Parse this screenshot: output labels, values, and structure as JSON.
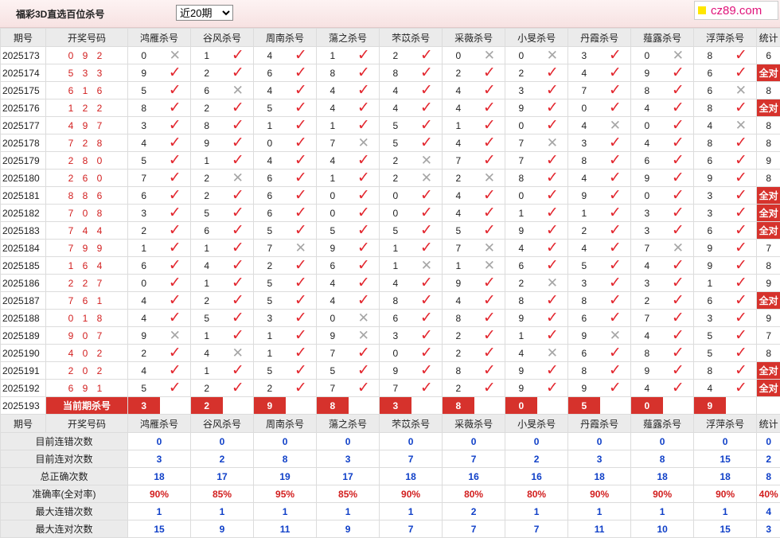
{
  "page": {
    "title": "福彩3D直选百位杀号",
    "select_value": "近20期",
    "logo_text": "cz89.com"
  },
  "header": {
    "period": "期号",
    "code": "开奖号码",
    "stat": "统计",
    "experts": [
      "鸿雁杀号",
      "谷风杀号",
      "周南杀号",
      "蕩之杀号",
      "芣苡杀号",
      "采薇杀号",
      "小旻杀号",
      "丹霞杀号",
      "薤露杀号",
      "浮萍杀号"
    ]
  },
  "rows": [
    {
      "p": "2025173",
      "c": "0 9 2",
      "n": [
        "0",
        "1",
        "4",
        "1",
        "2",
        "0",
        "0",
        "3",
        "0",
        "8"
      ],
      "r": [
        0,
        1,
        1,
        1,
        1,
        0,
        0,
        1,
        0,
        1
      ],
      "s": "6"
    },
    {
      "p": "2025174",
      "c": "5 3 3",
      "n": [
        "9",
        "2",
        "6",
        "8",
        "8",
        "2",
        "2",
        "4",
        "9",
        "6"
      ],
      "r": [
        1,
        1,
        1,
        1,
        1,
        1,
        1,
        1,
        1,
        1
      ],
      "s": "全对"
    },
    {
      "p": "2025175",
      "c": "6 1 6",
      "n": [
        "5",
        "6",
        "4",
        "4",
        "4",
        "4",
        "3",
        "7",
        "8",
        "6"
      ],
      "r": [
        1,
        0,
        1,
        1,
        1,
        1,
        1,
        1,
        1,
        0
      ],
      "s": "8"
    },
    {
      "p": "2025176",
      "c": "1 2 2",
      "n": [
        "8",
        "2",
        "5",
        "4",
        "4",
        "4",
        "9",
        "0",
        "4",
        "8"
      ],
      "r": [
        1,
        1,
        1,
        1,
        1,
        1,
        1,
        1,
        1,
        1
      ],
      "s": "全对"
    },
    {
      "p": "2025177",
      "c": "4 9 7",
      "n": [
        "3",
        "8",
        "1",
        "1",
        "5",
        "1",
        "0",
        "4",
        "0",
        "4"
      ],
      "r": [
        1,
        1,
        1,
        1,
        1,
        1,
        1,
        0,
        1,
        0
      ],
      "s": "8"
    },
    {
      "p": "2025178",
      "c": "7 2 8",
      "n": [
        "4",
        "9",
        "0",
        "7",
        "5",
        "4",
        "7",
        "3",
        "4",
        "8"
      ],
      "r": [
        1,
        1,
        1,
        0,
        1,
        1,
        0,
        1,
        1,
        1
      ],
      "s": "8"
    },
    {
      "p": "2025179",
      "c": "2 8 0",
      "n": [
        "5",
        "1",
        "4",
        "4",
        "2",
        "7",
        "7",
        "8",
        "6",
        "6"
      ],
      "r": [
        1,
        1,
        1,
        1,
        0,
        1,
        1,
        1,
        1,
        1
      ],
      "s": "9"
    },
    {
      "p": "2025180",
      "c": "2 6 0",
      "n": [
        "7",
        "2",
        "6",
        "1",
        "2",
        "2",
        "8",
        "4",
        "9",
        "9"
      ],
      "r": [
        1,
        0,
        1,
        1,
        0,
        0,
        1,
        1,
        1,
        1
      ],
      "s": "8"
    },
    {
      "p": "2025181",
      "c": "8 8 6",
      "n": [
        "6",
        "2",
        "6",
        "0",
        "0",
        "4",
        "0",
        "9",
        "0",
        "3"
      ],
      "r": [
        1,
        1,
        1,
        1,
        1,
        1,
        1,
        1,
        1,
        1
      ],
      "s": "全对"
    },
    {
      "p": "2025182",
      "c": "7 0 8",
      "n": [
        "3",
        "5",
        "6",
        "0",
        "0",
        "4",
        "1",
        "1",
        "3",
        "3"
      ],
      "r": [
        1,
        1,
        1,
        1,
        1,
        1,
        1,
        1,
        1,
        1
      ],
      "s": "全对"
    },
    {
      "p": "2025183",
      "c": "7 4 4",
      "n": [
        "2",
        "6",
        "5",
        "5",
        "5",
        "5",
        "9",
        "2",
        "3",
        "6"
      ],
      "r": [
        1,
        1,
        1,
        1,
        1,
        1,
        1,
        1,
        1,
        1
      ],
      "s": "全对"
    },
    {
      "p": "2025184",
      "c": "7 9 9",
      "n": [
        "1",
        "1",
        "7",
        "9",
        "1",
        "7",
        "4",
        "4",
        "7",
        "9"
      ],
      "r": [
        1,
        1,
        0,
        1,
        1,
        0,
        1,
        1,
        0,
        1
      ],
      "s": "7"
    },
    {
      "p": "2025185",
      "c": "1 6 4",
      "n": [
        "6",
        "4",
        "2",
        "6",
        "1",
        "1",
        "6",
        "5",
        "4",
        "9"
      ],
      "r": [
        1,
        1,
        1,
        1,
        0,
        0,
        1,
        1,
        1,
        1
      ],
      "s": "8"
    },
    {
      "p": "2025186",
      "c": "2 2 7",
      "n": [
        "0",
        "1",
        "5",
        "4",
        "4",
        "9",
        "2",
        "3",
        "3",
        "1"
      ],
      "r": [
        1,
        1,
        1,
        1,
        1,
        1,
        0,
        1,
        1,
        1
      ],
      "s": "9"
    },
    {
      "p": "2025187",
      "c": "7 6 1",
      "n": [
        "4",
        "2",
        "5",
        "4",
        "8",
        "4",
        "8",
        "8",
        "2",
        "6"
      ],
      "r": [
        1,
        1,
        1,
        1,
        1,
        1,
        1,
        1,
        1,
        1
      ],
      "s": "全对"
    },
    {
      "p": "2025188",
      "c": "0 1 8",
      "n": [
        "4",
        "5",
        "3",
        "0",
        "6",
        "8",
        "9",
        "6",
        "7",
        "3"
      ],
      "r": [
        1,
        1,
        1,
        0,
        1,
        1,
        1,
        1,
        1,
        1
      ],
      "s": "9"
    },
    {
      "p": "2025189",
      "c": "9 0 7",
      "n": [
        "9",
        "1",
        "1",
        "9",
        "3",
        "2",
        "1",
        "9",
        "4",
        "5"
      ],
      "r": [
        0,
        1,
        1,
        0,
        1,
        1,
        1,
        0,
        1,
        1
      ],
      "s": "7"
    },
    {
      "p": "2025190",
      "c": "4 0 2",
      "n": [
        "2",
        "4",
        "1",
        "7",
        "0",
        "2",
        "4",
        "6",
        "8",
        "5"
      ],
      "r": [
        1,
        0,
        1,
        1,
        1,
        1,
        0,
        1,
        1,
        1
      ],
      "s": "8"
    },
    {
      "p": "2025191",
      "c": "2 0 2",
      "n": [
        "4",
        "1",
        "5",
        "5",
        "9",
        "8",
        "9",
        "8",
        "9",
        "8"
      ],
      "r": [
        1,
        1,
        1,
        1,
        1,
        1,
        1,
        1,
        1,
        1
      ],
      "s": "全对"
    },
    {
      "p": "2025192",
      "c": "6 9 1",
      "n": [
        "5",
        "2",
        "2",
        "7",
        "7",
        "2",
        "9",
        "9",
        "4",
        "4"
      ],
      "r": [
        1,
        1,
        1,
        1,
        1,
        1,
        1,
        1,
        1,
        1
      ],
      "s": "全对"
    }
  ],
  "current": {
    "p": "2025193",
    "label": "当前期杀号",
    "nums": [
      "3",
      "2",
      "9",
      "8",
      "3",
      "8",
      "0",
      "5",
      "0",
      "9"
    ],
    "stat": ""
  },
  "stats": [
    {
      "label": "目前连错次数",
      "v": [
        "0",
        "0",
        "0",
        "0",
        "0",
        "0",
        "0",
        "0",
        "0",
        "0"
      ],
      "s": "0",
      "cls": "blue"
    },
    {
      "label": "目前连对次数",
      "v": [
        "3",
        "2",
        "8",
        "3",
        "7",
        "7",
        "2",
        "3",
        "8",
        "15"
      ],
      "s": "2",
      "cls": "blue"
    },
    {
      "label": "总正确次数",
      "v": [
        "18",
        "17",
        "19",
        "17",
        "18",
        "16",
        "16",
        "18",
        "18",
        "18"
      ],
      "s": "8",
      "cls": "blue"
    },
    {
      "label": "准确率(全对率)",
      "v": [
        "90%",
        "85%",
        "95%",
        "85%",
        "90%",
        "80%",
        "80%",
        "90%",
        "90%",
        "90%"
      ],
      "s": "40%",
      "cls": "red"
    },
    {
      "label": "最大连错次数",
      "v": [
        "1",
        "1",
        "1",
        "1",
        "1",
        "2",
        "1",
        "1",
        "1",
        "1"
      ],
      "s": "4",
      "cls": "blue"
    },
    {
      "label": "最大连对次数",
      "v": [
        "15",
        "9",
        "11",
        "9",
        "7",
        "7",
        "7",
        "11",
        "10",
        "15"
      ],
      "s": "3",
      "cls": "blue"
    }
  ],
  "symbols": {
    "ok": "✓",
    "no": "✕"
  },
  "colors": {
    "accent": "#d6322c",
    "number_red": "#d21e1e",
    "stat_blue": "#1040c8"
  }
}
